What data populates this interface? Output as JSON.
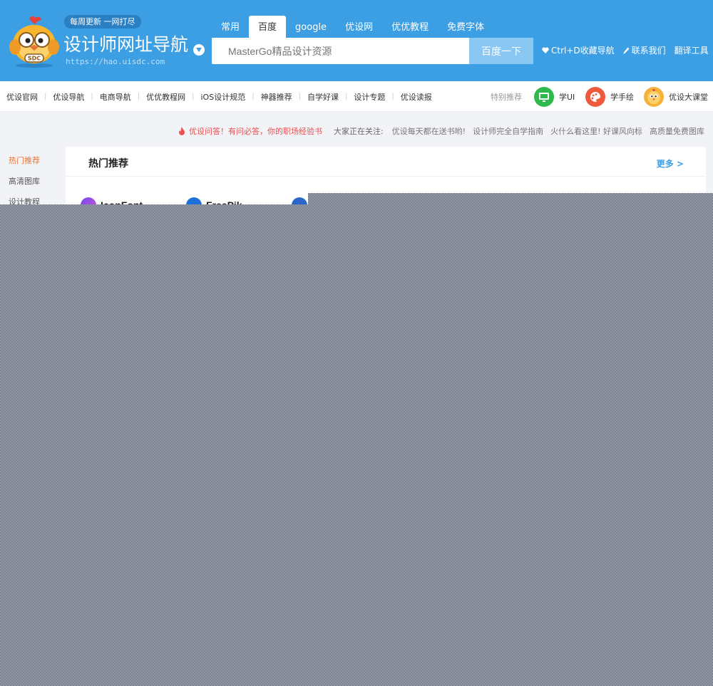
{
  "header": {
    "badge": "每周更新 一网打尽",
    "title": "设计师网址导航",
    "url": "https://hao.uisdc.com",
    "mascot_text": "SDC"
  },
  "search": {
    "tabs": [
      "常用",
      "百度",
      "google",
      "优设网",
      "优优教程",
      "免费字体"
    ],
    "active_tab": "百度",
    "placeholder": "MasterGo精品设计资源",
    "button_label": "百度一下"
  },
  "header_links": {
    "bookmark": "Ctrl+D收藏导航",
    "contact": "联系我们",
    "translate": "翻译工具"
  },
  "nav": {
    "items": [
      "优设官网",
      "优设导航",
      "电商导航",
      "优优教程网",
      "iOS设计规范",
      "神器推荐",
      "自学好课",
      "设计专题",
      "优设读报"
    ],
    "special_label": "特别推荐",
    "special": [
      "学UI",
      "学手绘",
      "优设大课堂"
    ]
  },
  "notice": {
    "hot": "优设问答！有问必答，你的职场经验书",
    "label": "大家正在关注:",
    "items": [
      "优设每天都在送书哟!",
      "设计师完全自学指南",
      "火什么看这里! 好课风向标",
      "高质量免费图库"
    ]
  },
  "sidebar": {
    "items": [
      "热门推荐",
      "高清图库",
      "设计教程"
    ],
    "active": "热门推荐"
  },
  "section": {
    "title": "热门推荐",
    "more": "更多 >",
    "sites": [
      "IconFont",
      "FreePik"
    ]
  },
  "colors": {
    "header_bg": "#3c9ee3",
    "search_button": "#8ac8f3",
    "active_sidebar": "#e8743a",
    "hot_notice": "#e84f4f"
  }
}
